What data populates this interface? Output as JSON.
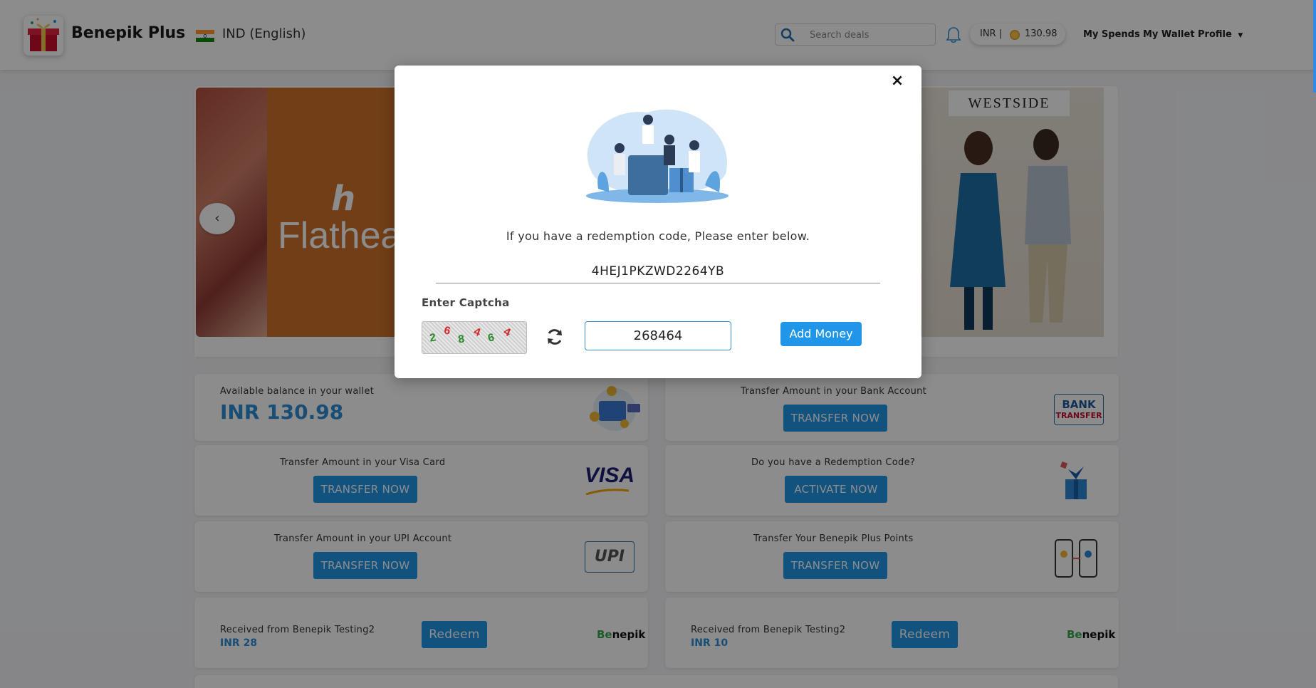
{
  "header": {
    "brand": "Benepik Plus",
    "locale": "IND (English)",
    "search_placeholder": "Search deals",
    "wallet_currency": "INR |",
    "wallet_amount": "130.98",
    "nav": {
      "my_spends": "My Spends",
      "my_wallet": "My Wallet",
      "profile": "Profile"
    }
  },
  "carousel": {
    "slide_logo": "h",
    "slide_text": "Flathea",
    "prev_label": "‹",
    "right_brand": "WESTSIDE"
  },
  "wallet_card": {
    "title": "Available balance in your wallet",
    "amount": "INR 130.98"
  },
  "cards": {
    "bank": {
      "title": "Transfer Amount in your Bank Account",
      "button": "TRANSFER NOW",
      "badge_line1": "BANK",
      "badge_line2": "TRANSFER"
    },
    "visa": {
      "title": "Transfer Amount in your Visa Card",
      "button": "TRANSFER NOW",
      "badge": "VISA"
    },
    "redemption": {
      "title": "Do you have a Redemption Code?",
      "button": "ACTIVATE NOW"
    },
    "upi": {
      "title": "Transfer Amount in your UPI Account",
      "button": "TRANSFER NOW",
      "badge": "UPI"
    },
    "points": {
      "title": "Transfer Your Benepik Plus Points",
      "button": "TRANSFER NOW"
    },
    "received_1": {
      "title": "Received from Benepik Testing2",
      "amount": "INR 28",
      "button": "Redeem",
      "logo_a": "Be",
      "logo_b": "nepik"
    },
    "received_2": {
      "title": "Received from Benepik Testing2",
      "amount": "INR 10",
      "button": "Redeem",
      "logo_a": "Be",
      "logo_b": "nepik"
    }
  },
  "modal": {
    "close_label": "×",
    "prompt": "If you have a redemption code, Please enter below.",
    "code_value": "4HEJ1PKZWD2264YB",
    "captcha_label": "Enter Captcha",
    "captcha_chars": [
      "2",
      "6",
      "8",
      "4",
      "6",
      "4"
    ],
    "captcha_colors": [
      "#2b8a2b",
      "#d12a2a",
      "#2b8a2b",
      "#d12a2a",
      "#2b8a2b",
      "#d12a2a"
    ],
    "captcha_value": "268464",
    "submit_label": "Add Money"
  }
}
